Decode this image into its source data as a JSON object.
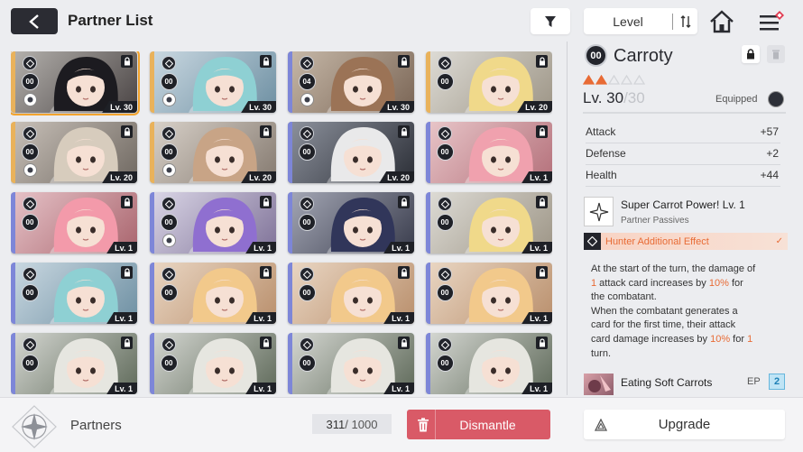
{
  "header": {
    "title": "Partner List",
    "sort_label": "Level",
    "icons": {
      "back": "back-arrow-icon",
      "filter": "filter-icon",
      "sort_order": "sort-order-icon",
      "home": "home-icon",
      "menu": "menu-icon"
    }
  },
  "partners": [
    {
      "rank": "00",
      "level": "Lv. 30",
      "strip": "#e9b25b",
      "bg": [
        "#b5b2ae",
        "#4a4444"
      ],
      "hair": "#1c1b20",
      "selected": true,
      "extra": true
    },
    {
      "rank": "00",
      "level": "Lv. 30",
      "strip": "#e9b25b",
      "bg": [
        "#cbd9e2",
        "#6d8fa2"
      ],
      "hair": "#8ed0d3",
      "selected": false,
      "extra": true
    },
    {
      "rank": "04",
      "level": "Lv. 30",
      "strip": "#7d86d8",
      "bg": [
        "#c7b9a9",
        "#7a6555"
      ],
      "hair": "#9b7356",
      "selected": false,
      "extra": true
    },
    {
      "rank": "00",
      "level": "Lv. 20",
      "strip": "#e9b25b",
      "bg": [
        "#dedcd6",
        "#9d9586"
      ],
      "hair": "#f0d98a",
      "selected": false,
      "extra": false
    },
    {
      "rank": "00",
      "level": "Lv. 20",
      "strip": "#e9b25b",
      "bg": [
        "#c9c1b9",
        "#6f6861"
      ],
      "hair": "#d7ccbd",
      "selected": false,
      "extra": true
    },
    {
      "rank": "00",
      "level": "Lv. 20",
      "strip": "#e9b25b",
      "bg": [
        "#d9d2ca",
        "#857a70"
      ],
      "hair": "#c8a486",
      "selected": false,
      "extra": true
    },
    {
      "rank": "00",
      "level": "Lv. 20",
      "strip": "#7d86d8",
      "bg": [
        "#8d929d",
        "#2b2e36"
      ],
      "hair": "#e9e9ea",
      "selected": false,
      "extra": false
    },
    {
      "rank": "00",
      "level": "Lv. 1",
      "strip": "#7d86d8",
      "bg": [
        "#e8c6c9",
        "#b4707a"
      ],
      "hair": "#f0a1ae",
      "selected": false,
      "extra": false
    },
    {
      "rank": "00",
      "level": "Lv. 1",
      "strip": "#7d86d8",
      "bg": [
        "#e6c3c8",
        "#a9646d"
      ],
      "hair": "#f39aaa",
      "selected": false,
      "extra": false
    },
    {
      "rank": "00",
      "level": "Lv. 1",
      "strip": "#7d86d8",
      "bg": [
        "#dbd7e7",
        "#7f7298"
      ],
      "hair": "#8f6fd0",
      "selected": false,
      "extra": true
    },
    {
      "rank": "00",
      "level": "Lv. 1",
      "strip": "#7d86d8",
      "bg": [
        "#a5a8b6",
        "#393c4c"
      ],
      "hair": "#31365a",
      "selected": false,
      "extra": false
    },
    {
      "rank": "00",
      "level": "Lv. 1",
      "strip": "#7d86d8",
      "bg": [
        "#dedcd6",
        "#9d9586"
      ],
      "hair": "#f0d98a",
      "selected": false,
      "extra": false
    },
    {
      "rank": "00",
      "level": "Lv. 1",
      "strip": "#7d86d8",
      "bg": [
        "#cbd9e2",
        "#6d8fa2"
      ],
      "hair": "#8ed0d3",
      "selected": false,
      "extra": false
    },
    {
      "rank": "00",
      "level": "Lv. 1",
      "strip": "#7d86d8",
      "bg": [
        "#ead7c4",
        "#b98f6c"
      ],
      "hair": "#f2c98b",
      "selected": false,
      "extra": false
    },
    {
      "rank": "00",
      "level": "Lv. 1",
      "strip": "#7d86d8",
      "bg": [
        "#ead7c4",
        "#b98f6c"
      ],
      "hair": "#f2c98b",
      "selected": false,
      "extra": false
    },
    {
      "rank": "00",
      "level": "Lv. 1",
      "strip": "#7d86d8",
      "bg": [
        "#ead7c4",
        "#b98f6c"
      ],
      "hair": "#f2c98b",
      "selected": false,
      "extra": false
    },
    {
      "rank": "00",
      "level": "Lv. 1",
      "strip": "#7d86d8",
      "bg": [
        "#d6d8d3",
        "#5f6a5a"
      ],
      "hair": "#e6e6e0",
      "selected": false,
      "extra": false
    },
    {
      "rank": "00",
      "level": "Lv. 1",
      "strip": "#7d86d8",
      "bg": [
        "#d6d8d3",
        "#5f6a5a"
      ],
      "hair": "#e6e6e0",
      "selected": false,
      "extra": false
    },
    {
      "rank": "00",
      "level": "Lv. 1",
      "strip": "#7d86d8",
      "bg": [
        "#d6d8d3",
        "#5f6a5a"
      ],
      "hair": "#e6e6e0",
      "selected": false,
      "extra": false
    },
    {
      "rank": "00",
      "level": "Lv. 1",
      "strip": "#7d86d8",
      "bg": [
        "#d6d8d3",
        "#5f6a5a"
      ],
      "hair": "#e6e6e0",
      "selected": false,
      "extra": false
    }
  ],
  "detail": {
    "rank": "00",
    "name": "Carroty",
    "stars_filled": 2,
    "stars_total": 5,
    "level_current": "Lv. 30",
    "level_max": "/30",
    "equipped_label": "Equipped",
    "stats": [
      {
        "label": "Attack",
        "value": "+57"
      },
      {
        "label": "Defense",
        "value": "+2"
      },
      {
        "label": "Health",
        "value": "+44"
      }
    ],
    "passive": {
      "name": "Super Carrot Power! Lv. 1",
      "type": "Partner Passives",
      "icon": "sparkle-icon"
    },
    "hunter_effect": "Hunter Additional Effect",
    "description": {
      "p1": "At the start of the turn, the damage of",
      "p2_num": "1",
      "p2_rest": " attack card increases by ",
      "p2_pct": "10%",
      "p2_end": " for",
      "p3": "the combatant.",
      "p4": "When the combatant generates a",
      "p5": "card for the first time, their attack",
      "p6": "card damage increases by ",
      "p6_pct": "10%",
      "p6_mid": " for ",
      "p6_num": "1",
      "p7": "turn."
    },
    "episode": {
      "name": "Eating Soft Carrots",
      "ep_label": "EP",
      "ep_count": "2"
    },
    "accent": "#e86b35"
  },
  "footer": {
    "section_label": "Partners",
    "count_current": "311",
    "count_max": " / 1000",
    "dismantle_label": "Dismantle",
    "upgrade_label": "Upgrade",
    "dismantle_color": "#d95a67"
  }
}
